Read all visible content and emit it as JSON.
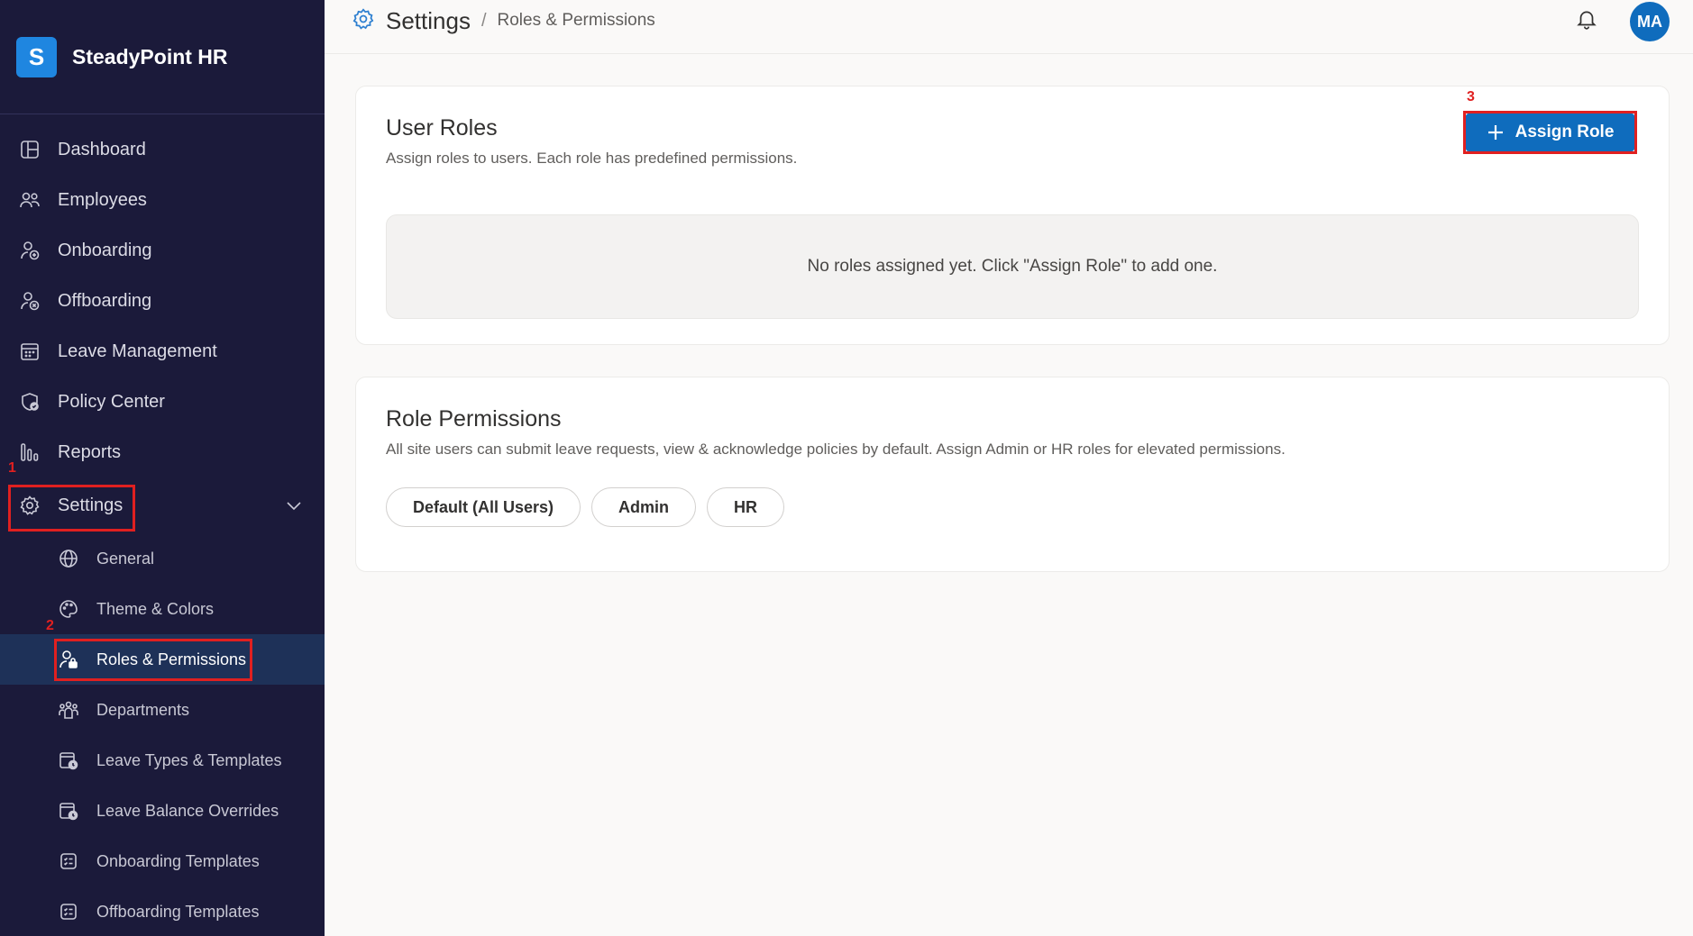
{
  "brand": {
    "logo_letter": "S",
    "name": "SteadyPoint HR"
  },
  "nav": {
    "items": [
      {
        "label": "Dashboard",
        "icon": "dashboard-icon"
      },
      {
        "label": "Employees",
        "icon": "people-icon"
      },
      {
        "label": "Onboarding",
        "icon": "person-add-icon"
      },
      {
        "label": "Offboarding",
        "icon": "person-remove-icon"
      },
      {
        "label": "Leave Management",
        "icon": "calendar-icon"
      },
      {
        "label": "Policy Center",
        "icon": "shield-check-icon"
      },
      {
        "label": "Reports",
        "icon": "bar-chart-icon"
      },
      {
        "label": "Settings",
        "icon": "gear-icon",
        "expanded": true
      }
    ],
    "settings_children": [
      {
        "label": "General",
        "icon": "globe-icon"
      },
      {
        "label": "Theme & Colors",
        "icon": "palette-icon"
      },
      {
        "label": "Roles & Permissions",
        "icon": "person-lock-icon",
        "active": true
      },
      {
        "label": "Departments",
        "icon": "people-team-icon"
      },
      {
        "label": "Leave Types & Templates",
        "icon": "calendar-clock-icon"
      },
      {
        "label": "Leave Balance Overrides",
        "icon": "calendar-clock-icon"
      },
      {
        "label": "Onboarding Templates",
        "icon": "checklist-icon"
      },
      {
        "label": "Offboarding Templates",
        "icon": "checklist-icon"
      }
    ]
  },
  "header": {
    "title": "Settings",
    "separator": "/",
    "breadcrumb": "Roles & Permissions",
    "avatar_initials": "MA"
  },
  "user_roles": {
    "title": "User Roles",
    "description": "Assign roles to users. Each role has predefined permissions.",
    "assign_button": "Assign Role",
    "empty_message": "No roles assigned yet. Click \"Assign Role\" to add one."
  },
  "role_permissions": {
    "title": "Role Permissions",
    "description": "All site users can submit leave requests, view & acknowledge policies by default. Assign Admin or HR roles for elevated permissions.",
    "roles": [
      "Default (All Users)",
      "Admin",
      "HR"
    ]
  },
  "annotations": {
    "mark1": "1",
    "mark2": "2",
    "mark3": "3"
  },
  "colors": {
    "sidebar_bg": "#1b1a3a",
    "accent": "#0f6cbd",
    "active_item_bg": "#1e3158",
    "annotation": "#e02020"
  }
}
